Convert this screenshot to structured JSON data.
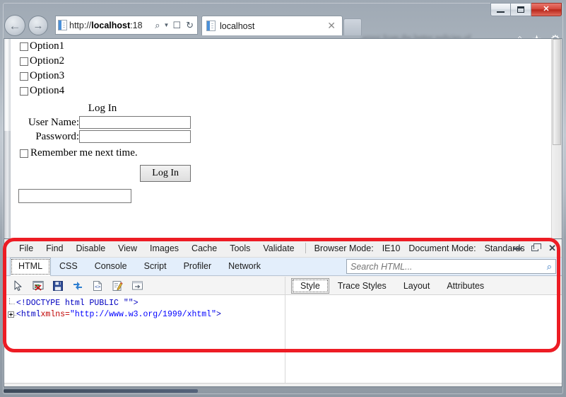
{
  "browser": {
    "window_controls": {
      "minimize": "minimize-button",
      "maximize": "restore-button",
      "close": "✕"
    },
    "nav": {
      "back": "←",
      "forward": "→"
    },
    "address": {
      "url_prefix": "http://",
      "url_host": "localhost",
      "url_suffix": ":18",
      "search_icon": "⌕",
      "dropdown_caret": "▼",
      "compat_icon": "compatibility-view-icon",
      "refresh_icon": "↻"
    },
    "tab": {
      "title": "localhost",
      "close": "✕"
    },
    "toolbar_icons": {
      "home": "⌂",
      "favorites": "★",
      "tools": "⚙"
    },
    "blurred_text": "arrest from the better policies of"
  },
  "page": {
    "options": [
      {
        "label": "Option1",
        "checked": false
      },
      {
        "label": "Option2",
        "checked": false
      },
      {
        "label": "Option3",
        "checked": false
      },
      {
        "label": "Option4",
        "checked": false
      }
    ],
    "login_heading": "Log In",
    "username_label": "User Name:",
    "username_value": "",
    "password_label": "Password:",
    "password_value": "",
    "remember_label": "Remember me next time.",
    "remember_checked": false,
    "login_button": "Log In",
    "bottom_input_value": ""
  },
  "devtools": {
    "menu": [
      "File",
      "Find",
      "Disable",
      "View",
      "Images",
      "Cache",
      "Tools",
      "Validate"
    ],
    "browser_mode_label": "Browser Mode:",
    "browser_mode_value": "IE10",
    "document_mode_label": "Document Mode:",
    "document_mode_value": "Standards",
    "window_controls": {
      "minimize": "minimize",
      "restore": "restore",
      "close": "✕"
    },
    "tabs": [
      {
        "label": "HTML",
        "active": true
      },
      {
        "label": "CSS",
        "active": false
      },
      {
        "label": "Console",
        "active": false
      },
      {
        "label": "Script",
        "active": false
      },
      {
        "label": "Profiler",
        "active": false
      },
      {
        "label": "Network",
        "active": false
      }
    ],
    "search": {
      "placeholder": "Search HTML...",
      "value": "",
      "icon": "⌕"
    },
    "icon_toolbar": [
      "select-element-icon",
      "clear-browser-cache-icon",
      "save-icon",
      "refresh-icon",
      "view-source-icon",
      "edit-icon",
      "outline-icon"
    ],
    "source": {
      "line1": {
        "text": "<!DOCTYPE html PUBLIC \"\">"
      },
      "line2": {
        "tag_open": "<html ",
        "attr": "xmlns",
        "eq": "=",
        "value": "\"http://www.w3.org/1999/xhtml\"",
        "tag_close": ">"
      }
    },
    "right_tabs": [
      {
        "label": "Style",
        "active": true
      },
      {
        "label": "Trace Styles",
        "active": false
      },
      {
        "label": "Layout",
        "active": false
      },
      {
        "label": "Attributes",
        "active": false
      }
    ]
  },
  "annotation": {
    "color": "#ed1c24",
    "shape": "rounded-rectangle"
  }
}
